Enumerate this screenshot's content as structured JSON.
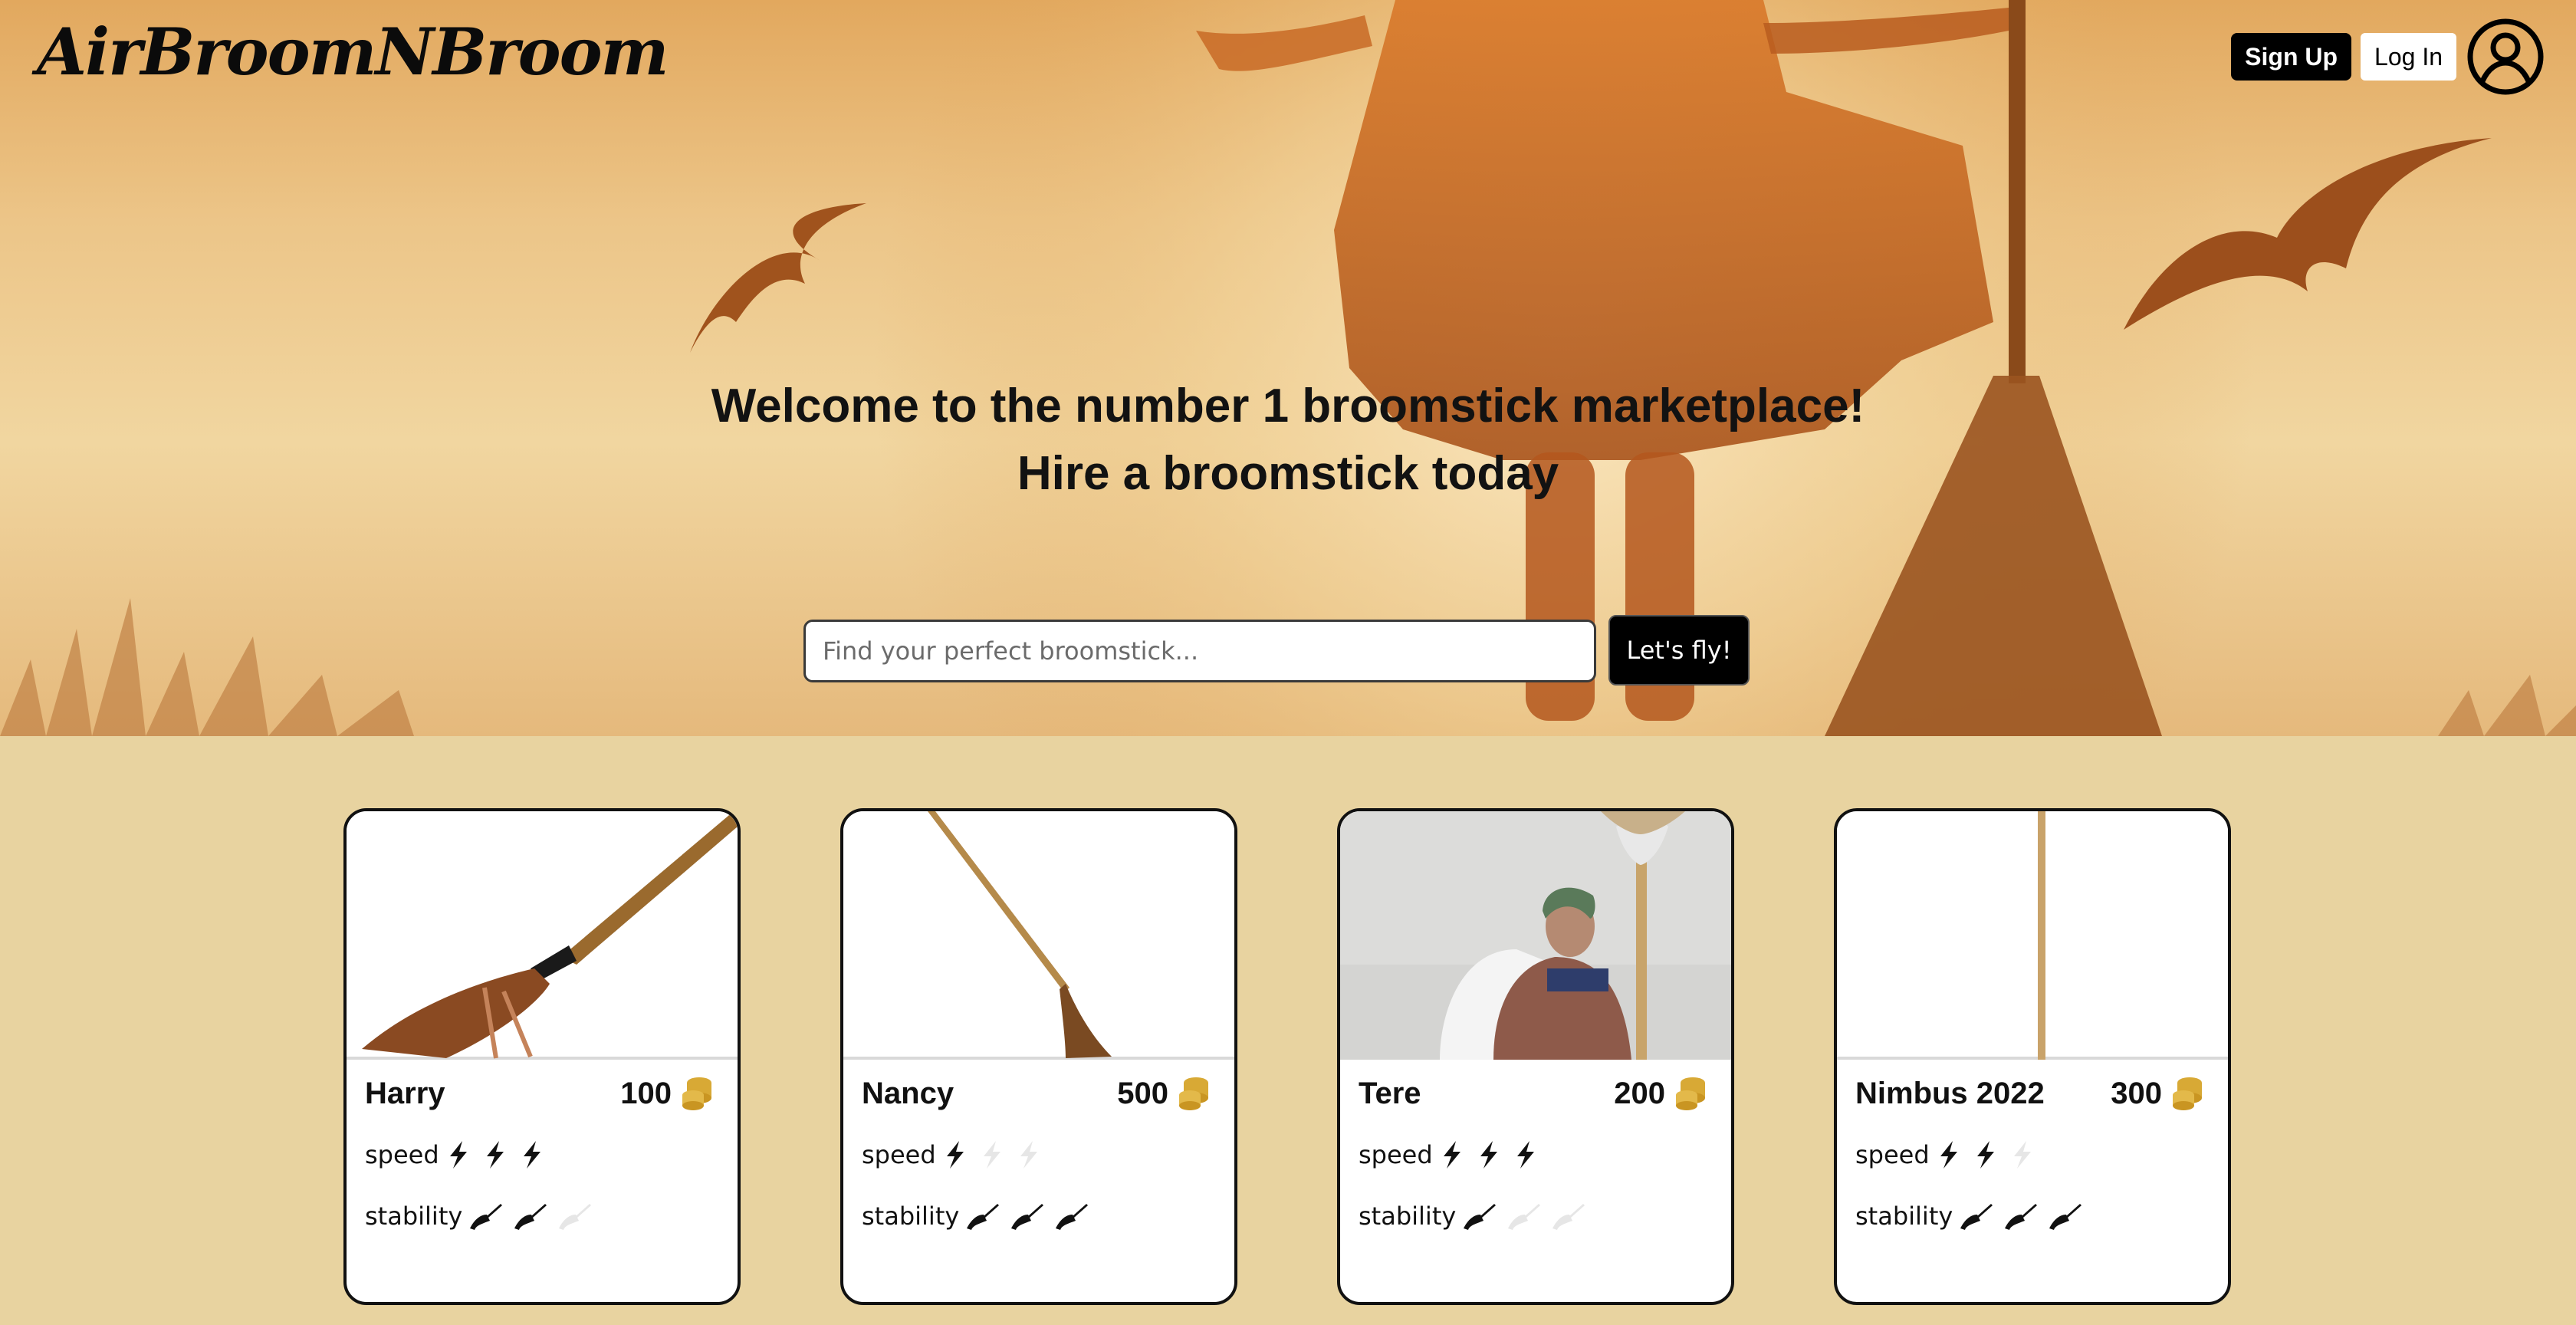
{
  "header": {
    "logo": "AirBroomNBroom",
    "signup_label": "Sign Up",
    "login_label": "Log In",
    "avatar_icon": "user-circle-icon"
  },
  "hero": {
    "headline_line1": "Welcome to the number 1 broomstick marketplace!",
    "headline_line2": "Hire a broomstick today",
    "search_placeholder": "Find your perfect broomstick...",
    "search_value": "",
    "search_button": "Let's fly!"
  },
  "listings": [
    {
      "name": "Harry",
      "price": "100",
      "speed": 3,
      "stability": 2,
      "speed_label": "speed",
      "stability_label": "stability"
    },
    {
      "name": "Nancy",
      "price": "500",
      "speed": 1,
      "stability": 3,
      "speed_label": "speed",
      "stability_label": "stability"
    },
    {
      "name": "Tere",
      "price": "200",
      "speed": 3,
      "stability": 1,
      "speed_label": "speed",
      "stability_label": "stability"
    },
    {
      "name": "Nimbus 2022",
      "price": "300",
      "speed": 2,
      "stability": 3,
      "speed_label": "speed",
      "stability_label": "stability"
    }
  ],
  "rating_max": 3,
  "colors": {
    "page_bg": "#e8d3a0",
    "coin": "#d8a935",
    "icon_active": "#111111",
    "icon_inactive": "#e6e6e6"
  },
  "icons": {
    "price": "coins-icon",
    "speed": "lightning-bolt-icon",
    "stability": "broom-icon"
  }
}
